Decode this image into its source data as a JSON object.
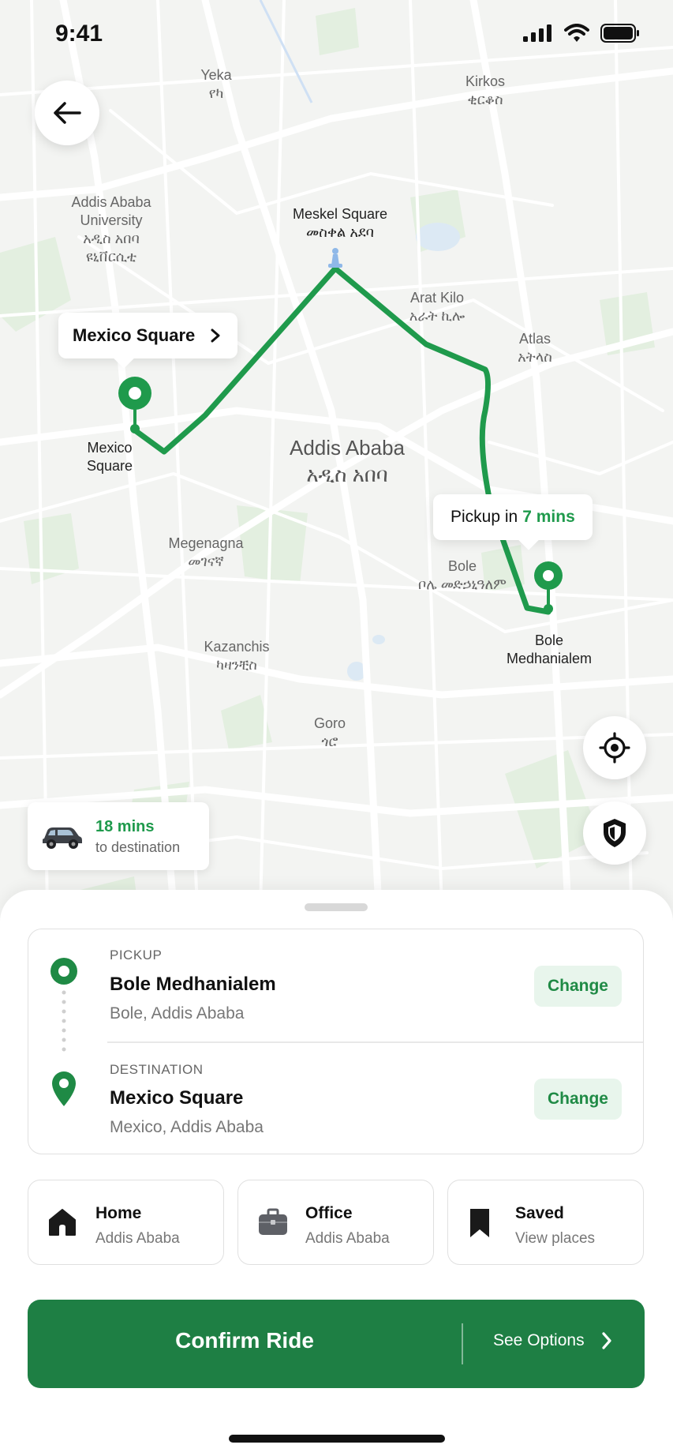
{
  "status_bar": {
    "time": "9:41"
  },
  "map": {
    "labels": {
      "yeka": "Yeka\nየካ",
      "kirkos": "Kirkos\nቂርቆስ",
      "university": "Addis Ababa\nUniversity\nአዲስ አበባ\nዩኒቨርሲቲ",
      "meskel": "Meskel Square\nመስቀል አደባ",
      "arat_kilo": "Arat Kilo\nአራት ኪሎ",
      "atlas": "Atlas\nአትላስ",
      "mexico": "Mexico\nSquare",
      "city": "Addis Ababa\nአዲስ አበባ",
      "megenagna": "Megenagna\nመገናኛ",
      "bole": "Bole\nቦሌ መድኃኒዓለም",
      "bole_medhanialem": "Bole\nMedhanialem",
      "kazanchis": "Kazanchis\nካዛንቺስ",
      "goro": "Goro\nጎሮ"
    },
    "callout_destination": "Mexico Square",
    "callout_pickup": {
      "prefix": "Pickup in",
      "time": "7 mins"
    },
    "eta": {
      "time": "18 mins",
      "label": "to destination"
    },
    "route_color": "#1f9a4c"
  },
  "sheet": {
    "pickup": {
      "tag": "PICKUP",
      "title": "Bole Medhanialem",
      "subtitle": "Bole, Addis Ababa",
      "action": "Change"
    },
    "destination": {
      "tag": "DESTINATION",
      "title": "Mexico Square",
      "subtitle": "Mexico, Addis Ababa",
      "action": "Change"
    },
    "places": [
      {
        "title": "Home",
        "subtitle": "Addis Ababa",
        "icon": "home-icon"
      },
      {
        "title": "Office",
        "subtitle": "Addis Ababa",
        "icon": "briefcase-icon"
      },
      {
        "title": "Saved",
        "subtitle": "View places",
        "icon": "bookmark-icon"
      }
    ],
    "confirm": {
      "label": "Confirm Ride",
      "options": "See Options"
    }
  },
  "colors": {
    "brand_green": "#1e7f44",
    "accent_green": "#1f9a4c",
    "chip_bg": "#e8f5ec"
  }
}
